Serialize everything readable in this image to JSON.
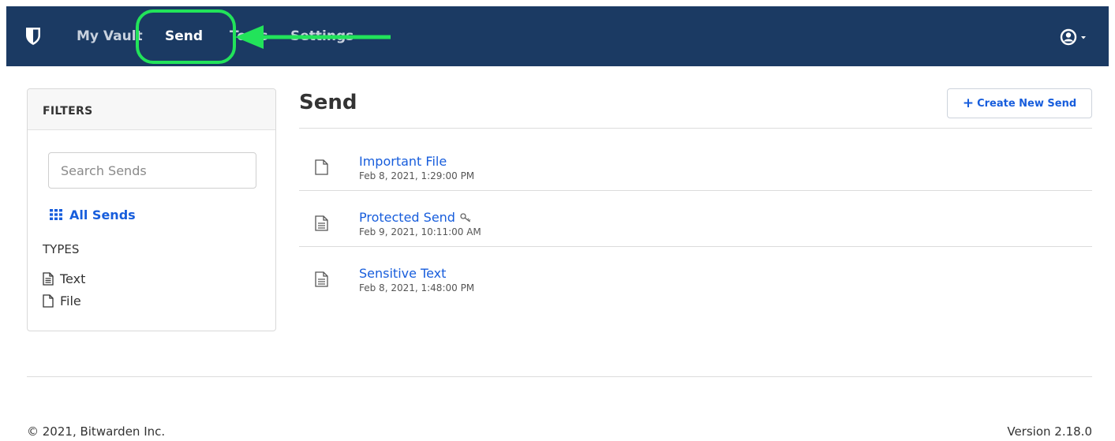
{
  "nav": {
    "my_vault": "My Vault",
    "send": "Send",
    "tools": "Tools",
    "settings": "Settings",
    "brand_color": "#1b3a63"
  },
  "filters": {
    "header": "FILTERS",
    "search_placeholder": "Search Sends",
    "all_sends": "All Sends",
    "types_heading": "TYPES",
    "types": [
      "Text",
      "File"
    ]
  },
  "main": {
    "title": "Send",
    "create_button": "Create New Send",
    "sends": [
      {
        "name": "Important File",
        "date": "Feb 8, 2021, 1:29:00 PM",
        "icon": "file-icon",
        "protected": false
      },
      {
        "name": "Protected Send",
        "date": "Feb 9, 2021, 10:11:00 AM",
        "icon": "text-file-icon",
        "protected": true
      },
      {
        "name": "Sensitive Text",
        "date": "Feb 8, 2021, 1:48:00 PM",
        "icon": "text-file-icon",
        "protected": false
      }
    ]
  },
  "footer": {
    "copyright": "© 2021, Bitwarden Inc.",
    "version": "Version 2.18.0"
  },
  "colors": {
    "link": "#175ddc",
    "annotation": "#22e35a"
  }
}
